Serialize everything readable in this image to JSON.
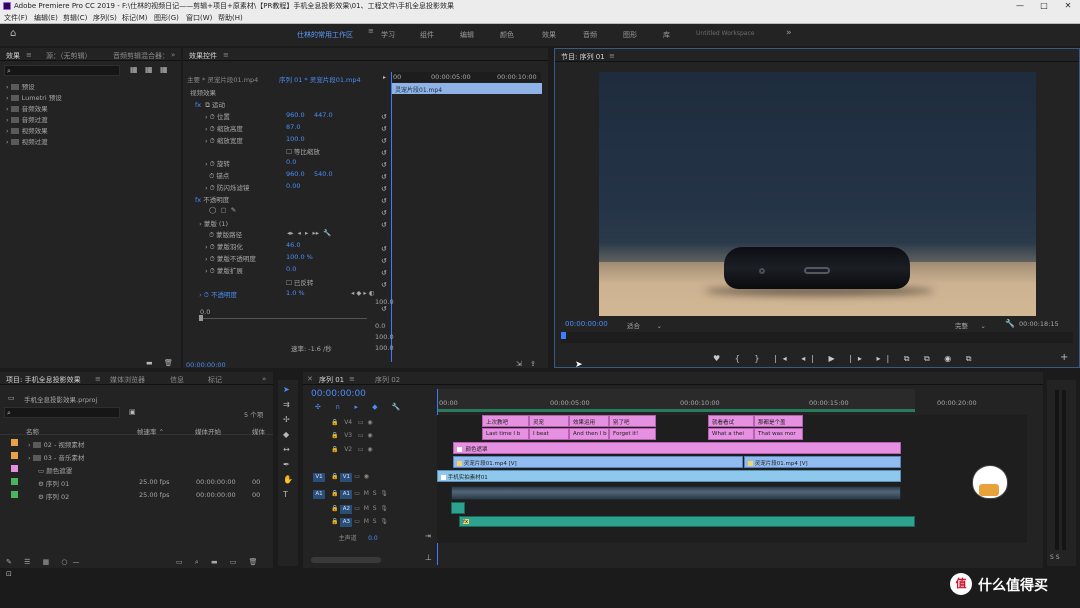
{
  "window": {
    "title": "Adobe Premiere Pro CC 2019 - F:\\仕林的视频日记——剪辑+项目+原素材\\【PR教程】手机全息投影效果\\01、工程文件\\手机全息投影效果",
    "min": "—",
    "max": "□",
    "close": "✕"
  },
  "menu": [
    "文件(F)",
    "编辑(E)",
    "剪辑(C)",
    "序列(S)",
    "标记(M)",
    "图形(G)",
    "窗口(W)",
    "帮助(H)"
  ],
  "workspaces": {
    "items": [
      "仕林的常用工作区",
      "学习",
      "组件",
      "编辑",
      "颜色",
      "效果",
      "音频",
      "图形",
      "库",
      "Untitled Workspace"
    ],
    "more": "»"
  },
  "effects_panel": {
    "tabs": [
      "效果",
      "源：（无剪辑）",
      "音频剪辑混合器：",
      "效果控件"
    ],
    "items": [
      "预设",
      "Lumetri 预设",
      "音频效果",
      "音频过渡",
      "视频效果",
      "视频过渡"
    ]
  },
  "effect_controls": {
    "master": "主要 * 灵宠片段01.mp4",
    "sequence_clip": "序列 01 * 灵宠片段01.mp4",
    "clip_name": "灵宠片段01.mp4",
    "tl_time1": "00:00:05:00",
    "tl_time2": "00:00:10:00",
    "section_video": "视频效果",
    "motion": "运动",
    "position_label": "位置",
    "position_x": "960.0",
    "position_y": "447.0",
    "scale_h_label": "缩放高度",
    "scale_h": "87.0",
    "scale_w_label": "缩放宽度",
    "scale_w": "100.0",
    "uniform_label": "等比缩放",
    "rotation_label": "旋转",
    "rotation": "0.0",
    "anchor_label": "锚点",
    "anchor_x": "960.0",
    "anchor_y": "540.0",
    "flicker_label": "防闪烁滤镜",
    "flicker": "0.00",
    "opacity_section": "不透明度",
    "mask_label": "蒙版 (1)",
    "mask_path_label": "蒙版路径",
    "mask_feather_label": "蒙版羽化",
    "mask_feather": "46.0",
    "mask_opacity_label": "蒙版不透明度",
    "mask_opacity": "100.0 %",
    "mask_expand_label": "蒙版扩展",
    "mask_expand": "0.0",
    "inverted_label": "已反转",
    "opacity_label": "不透明度",
    "opacity": "1.0 %",
    "graph_top": "100.0",
    "graph_zero": "0.0",
    "graph_100b": "100.0",
    "graph_0b": "0.0",
    "graph_100c": "100.0",
    "velocity": "速率: -1.6 /秒",
    "timecode": "00:00:00:00"
  },
  "program": {
    "title": "节目: 序列 01",
    "timecode": "00:00:00:00",
    "fit": "适合",
    "quality": "完整",
    "duration": "00:00:18:15"
  },
  "project": {
    "tabs": [
      "项目: 手机全息投影效果",
      "媒体浏览器",
      "信息",
      "标记"
    ],
    "file": "手机全息投影效果.prproj",
    "count": "5 个项",
    "headers": [
      "名称",
      "帧速率",
      "媒体开始",
      "媒体"
    ],
    "rows": [
      {
        "name": "02 - 视频素材",
        "color": "#e9a04a",
        "fps": "",
        "start": "",
        "end": "",
        "kind": "bin"
      },
      {
        "name": "03 - 音乐素材",
        "color": "#e9a04a",
        "fps": "",
        "start": "",
        "end": "",
        "kind": "bin"
      },
      {
        "name": "颜色遮罩",
        "color": "#e58fe3",
        "fps": "",
        "start": "",
        "end": "",
        "kind": "item"
      },
      {
        "name": "序列 01",
        "color": "#4cb35f",
        "fps": "25.00 fps",
        "start": "00:00:00:00",
        "end": "00",
        "kind": "seq"
      },
      {
        "name": "序列 02",
        "color": "#4cb35f",
        "fps": "25.00 fps",
        "start": "00:00:00:00",
        "end": "00",
        "kind": "seq"
      }
    ]
  },
  "timeline": {
    "tabs": [
      "序列 01",
      "序列 02"
    ],
    "timecode": "00:00:00:00",
    "ruler": [
      "00:00",
      "00:00:05:00",
      "00:00:10:00",
      "00:00:15:00",
      "00:00:20:00"
    ],
    "tracks": [
      "V4",
      "V3",
      "V2",
      "V1",
      "A1",
      "A2",
      "A3"
    ],
    "master": "主声道",
    "master_val": "0.0",
    "src_v1": "V1",
    "src_a1": "A1",
    "mute": "M",
    "solo": "S",
    "clips": {
      "v4": [
        "上次教吧",
        "灵宠",
        "效果运用",
        "别了吧",
        "就看看试",
        "那都是个盖"
      ],
      "v3": [
        "Last time I b",
        "I beat",
        "And then I b",
        "Forget it!",
        "What a thei",
        "That was mor"
      ],
      "v2": "颜色遮罩",
      "v1a": "灵宠片段01.mp4 [V]",
      "v1b": "灵宠片段01.mp4 [V]",
      "v0": "手机实拍素材01",
      "fx": "fx"
    }
  },
  "watermark": {
    "icon": "值",
    "text": "什么值得买"
  }
}
